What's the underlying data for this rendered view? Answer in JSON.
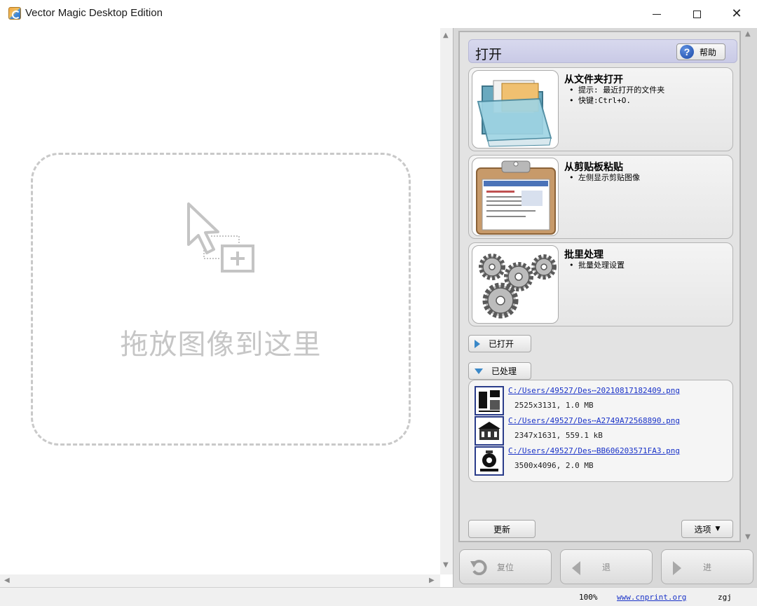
{
  "window": {
    "title": "Vector Magic Desktop Edition",
    "minimize_icon": "minimize-icon",
    "maximize_icon": "maximize-icon",
    "close_icon": "close-icon"
  },
  "canvas": {
    "drop_text": "拖放图像到这里",
    "drop_icon": "drag-cursor-add-icon"
  },
  "panel": {
    "section_title": "打开",
    "help_label": "帮助",
    "cards": [
      {
        "title": "从文件夹打开",
        "tips": [
          "提示: 最近打开的文件夹",
          "快键:Ctrl+O."
        ],
        "icon": "folder-icon"
      },
      {
        "title": "从剪贴板粘贴",
        "tips": [
          "左侧显示剪贴图像"
        ],
        "icon": "clipboard-icon"
      },
      {
        "title": "批里处理",
        "tips": [
          "批量处理设置"
        ],
        "icon": "gears-icon"
      }
    ],
    "opened_label": "已打开",
    "processed_label": "已处理",
    "files": [
      {
        "path": "C:/Users/49527/Des⋯20210817182409.png",
        "meta": "2525x3131, 1.0 MB"
      },
      {
        "path": "C:/Users/49527/Des⋯A2749A72568890.png",
        "meta": "2347x1631, 559.1 kB"
      },
      {
        "path": "C:/Users/49527/Des⋯BB606203571FA3.png",
        "meta": "3500x4096, 2.0 MB"
      }
    ],
    "refresh_label": "更新",
    "options_label": "选项"
  },
  "nav": {
    "reset_label": "复位",
    "back_label": "退",
    "forward_label": "进"
  },
  "status": {
    "zoom": "100%",
    "link": "www.cnprint.org",
    "user": "zgj"
  },
  "colors": {
    "accent": "#3a88c8",
    "link": "#1a33c8",
    "header_bg": "#d0d1ea"
  }
}
